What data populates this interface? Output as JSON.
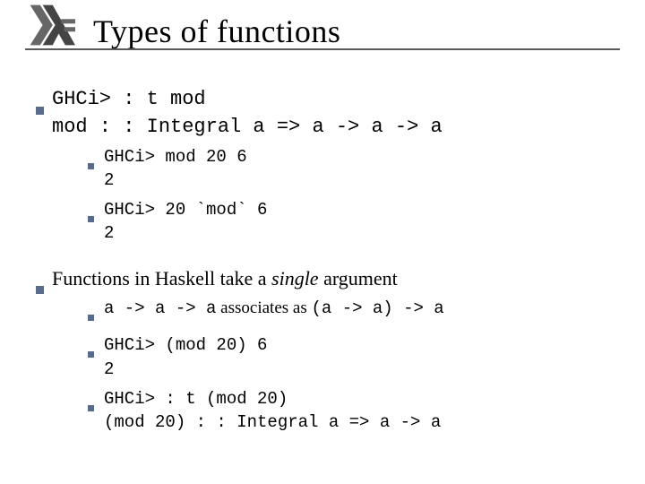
{
  "title": "Types of functions",
  "b1": {
    "l1": "GHCi> : t mod",
    "l2": "mod : : Integral a => a -> a -> a",
    "s1": {
      "l1": "GHCi> mod 20 6",
      "l2": "2"
    },
    "s2": {
      "l1": "GHCi> 20 `mod` 6",
      "l2": "2"
    }
  },
  "b2": {
    "pre": "Functions in Haskell take a ",
    "em": "single",
    "post": " argument",
    "s1": {
      "c1": "a -> a -> a",
      "mid": " associates as ",
      "c2": "(a -> a) -> a"
    },
    "s2": {
      "l1": "GHCi> (mod 20) 6",
      "l2": "2"
    },
    "s3": {
      "l1": "GHCi> : t (mod 20)",
      "l2": "(mod 20) : : Integral a => a -> a"
    }
  }
}
